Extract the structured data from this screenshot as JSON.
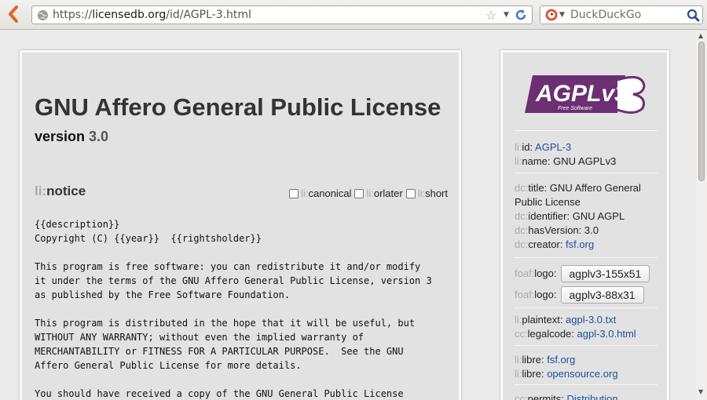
{
  "browser": {
    "url_scheme": "https://",
    "url_host": "licensedb.org",
    "url_path": "/id/AGPL-3.html",
    "search_placeholder": "DuckDuckGo"
  },
  "main": {
    "title": "GNU Affero General Public License",
    "version_label": "version",
    "version_number": "3.0",
    "notice_prefix": "li:",
    "notice_label": "notice",
    "checkboxes": [
      {
        "prefix": "li:",
        "label": "canonical"
      },
      {
        "prefix": "li:",
        "label": "orlater"
      },
      {
        "prefix": "li:",
        "label": "short"
      }
    ],
    "notice_text": "{{description}}\nCopyright (C) {{year}}  {{rightsholder}}\n\nThis program is free software: you can redistribute it and/or modify\nit under the terms of the GNU Affero General Public License, version 3\nas published by the Free Software Foundation.\n\nThis program is distributed in the hope that it will be useful, but\nWITHOUT ANY WARRANTY; without even the implied warranty of\nMERCHANTABILITY or FITNESS FOR A PARTICULAR PURPOSE.  See the GNU\nAffero General Public License for more details.\n\nYou should have received a copy of the GNU General Public License"
  },
  "sidebar": {
    "logo_text": "AGPLv3",
    "logo_subtext": "Free Software",
    "id": {
      "prefix": "li:",
      "key": "id",
      "value": "AGPL-3"
    },
    "name": {
      "prefix": "li:",
      "key": "name",
      "value": "GNU AGPLv3"
    },
    "dc_title": {
      "prefix": "dc:",
      "key": "title",
      "value": "GNU Affero General Public License"
    },
    "dc_identifier": {
      "prefix": "dc:",
      "key": "identifier",
      "value": "GNU AGPL"
    },
    "dc_hasVersion": {
      "prefix": "dc:",
      "key": "hasVersion",
      "value": "3.0"
    },
    "dc_creator": {
      "prefix": "dc:",
      "key": "creator",
      "value": "fsf.org"
    },
    "logos": [
      {
        "prefix": "foaf:",
        "key": "logo",
        "value": "agplv3-155x51"
      },
      {
        "prefix": "foaf:",
        "key": "logo",
        "value": "agplv3-88x31"
      }
    ],
    "plaintext": {
      "prefix": "li:",
      "key": "plaintext",
      "value": "agpl-3.0.txt"
    },
    "legalcode": {
      "prefix": "cc:",
      "key": "legalcode",
      "value": "agpl-3.0.html"
    },
    "libre": [
      {
        "prefix": "li:",
        "key": "libre",
        "value": "fsf.org"
      },
      {
        "prefix": "li:",
        "key": "libre",
        "value": "opensource.org"
      }
    ],
    "permits": {
      "prefix": "cc:",
      "key": "permits",
      "value": "Distribution"
    }
  },
  "colors": {
    "accent_link": "#1d4f9e",
    "logo_purple": "#6b2f72"
  }
}
